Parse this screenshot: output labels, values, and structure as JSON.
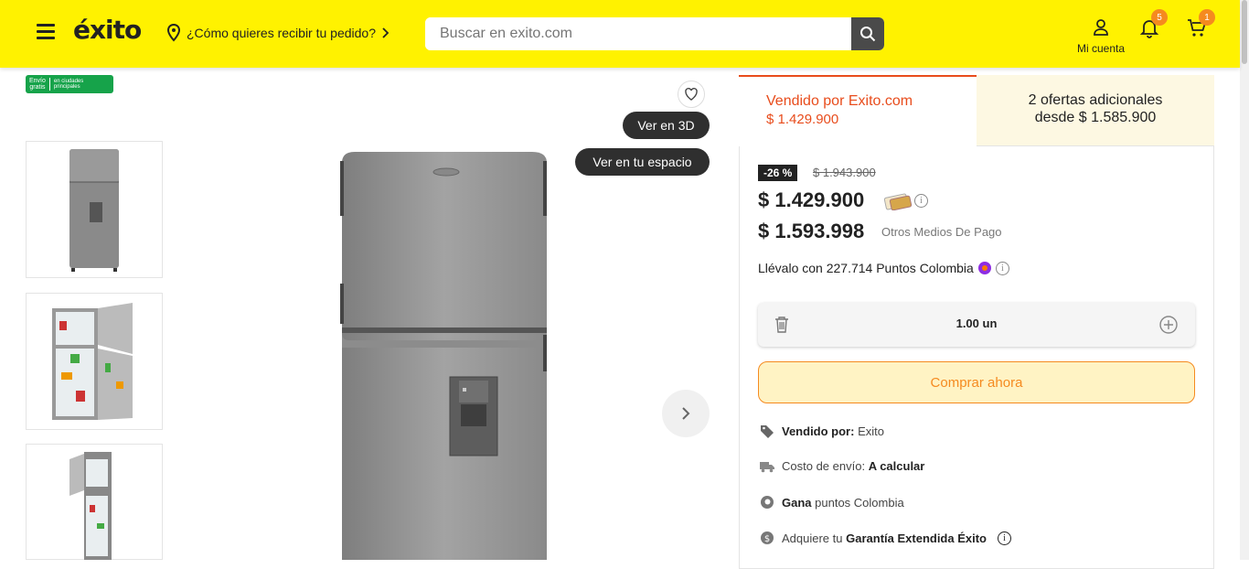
{
  "header": {
    "logo": "éxito",
    "location_prompt": "¿Cómo quieres recibir tu pedido?",
    "search_placeholder": "Buscar en exito.com",
    "account_label": "Mi cuenta",
    "notifications_count": "5",
    "cart_count": "1"
  },
  "badge_envio": {
    "line1": "Envío",
    "line2": "gratis",
    "note1": "en ciudades",
    "note2": "principales"
  },
  "gallery": {
    "view_3d_label": "Ver en 3D",
    "view_space_label": "Ver en tu espacio",
    "thumbnails": [
      "refrigerator-front",
      "refrigerator-open-doors",
      "refrigerator-side-open"
    ]
  },
  "offers": {
    "sold_by_tab": "Vendido por Exito.com",
    "sold_by_price": "$ 1.429.900",
    "additional_line1": "2 ofertas adicionales",
    "additional_line2": "desde $ 1.585.900"
  },
  "pricing": {
    "discount": "-26 %",
    "old_price": "$ 1.943.900",
    "card_price": "$ 1.429.900",
    "other_price": "$ 1.593.998",
    "other_label": "Otros Medios De Pago",
    "points_text": "Llévalo con 227.714 Puntos Colombia"
  },
  "quantity": {
    "value": "1.00 un"
  },
  "buy_label": "Comprar ahora",
  "features": {
    "seller_label": "Vendido por:",
    "seller_value": "Exito",
    "shipping_label": "Costo de envío:",
    "shipping_value": "A calcular",
    "points_bold": "Gana",
    "points_text": "puntos Colombia",
    "warranty_text": "Adquiere tu",
    "warranty_bold": "Garantía Extendida Éxito"
  },
  "colors": {
    "brand_yellow": "#fff200",
    "accent_orange": "#f58a1f",
    "sold_by_red": "#e84c1c"
  }
}
